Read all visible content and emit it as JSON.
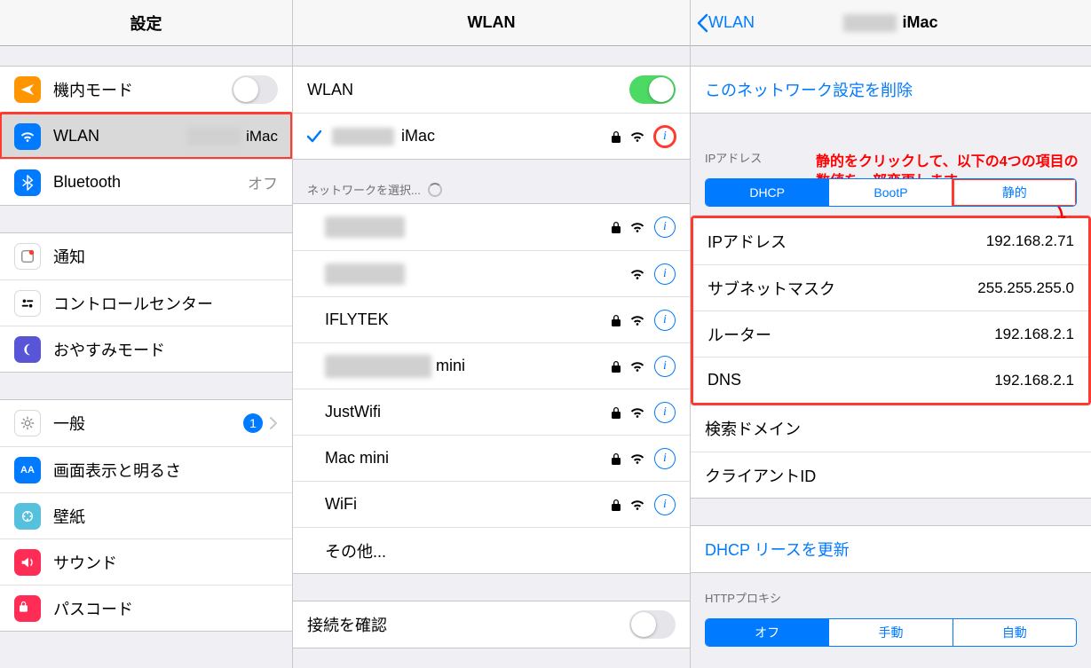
{
  "left": {
    "title": "設定",
    "groups": [
      [
        {
          "icon": "airplane",
          "label": "機内モード",
          "type": "toggle",
          "on": false
        },
        {
          "icon": "wlan",
          "label": "WLAN",
          "value": "iMac",
          "selected": true,
          "highlighted": true
        },
        {
          "icon": "bt",
          "label": "Bluetooth",
          "value": "オフ"
        }
      ],
      [
        {
          "icon": "notify",
          "label": "通知"
        },
        {
          "icon": "cc",
          "label": "コントロールセンター"
        },
        {
          "icon": "dnd",
          "label": "おやすみモード"
        }
      ],
      [
        {
          "icon": "general",
          "label": "一般",
          "badge": "1"
        },
        {
          "icon": "display",
          "label": "画面表示と明るさ"
        },
        {
          "icon": "wallpaper",
          "label": "壁紙"
        },
        {
          "icon": "sound",
          "label": "サウンド"
        },
        {
          "icon": "passcode",
          "label": "パスコード"
        }
      ]
    ]
  },
  "middle": {
    "title": "WLAN",
    "wlan_label": "WLAN",
    "wlan_on": true,
    "connected": {
      "name": "iMac",
      "locked": true,
      "info_highlight": true
    },
    "choose_header": "ネットワークを選択...",
    "networks": [
      {
        "name": "",
        "blurred": true,
        "locked": true
      },
      {
        "name": "",
        "blurred": true,
        "locked": false
      },
      {
        "name": "IFLYTEK",
        "locked": true
      },
      {
        "name": "mini",
        "blurred_prefix": true,
        "locked": true
      },
      {
        "name": "JustWifi",
        "locked": true
      },
      {
        "name": "Mac mini",
        "locked": true
      },
      {
        "name": "WiFi",
        "locked": true
      }
    ],
    "other_label": "その他...",
    "ask_label": "接続を確認"
  },
  "right": {
    "back": "WLAN",
    "title": "iMac",
    "forget": "このネットワーク設定を削除",
    "annotation": "静的をクリックして、以下の4つの項目の数値を一部変更します。",
    "ip_header": "IPアドレス",
    "tabs": [
      "DHCP",
      "BootP",
      "静的"
    ],
    "active_tab": 0,
    "highlight_tab": 2,
    "fields": [
      {
        "label": "IPアドレス",
        "value": "192.168.2.71"
      },
      {
        "label": "サブネットマスク",
        "value": "255.255.255.0"
      },
      {
        "label": "ルーター",
        "value": "192.168.2.1"
      },
      {
        "label": "DNS",
        "value": "192.168.2.1"
      }
    ],
    "search_domain": "検索ドメイン",
    "client_id": "クライアントID",
    "renew": "DHCP リースを更新",
    "proxy_header": "HTTPプロキシ",
    "proxy_tabs": [
      "オフ",
      "手動",
      "自動"
    ],
    "proxy_active": 0
  }
}
